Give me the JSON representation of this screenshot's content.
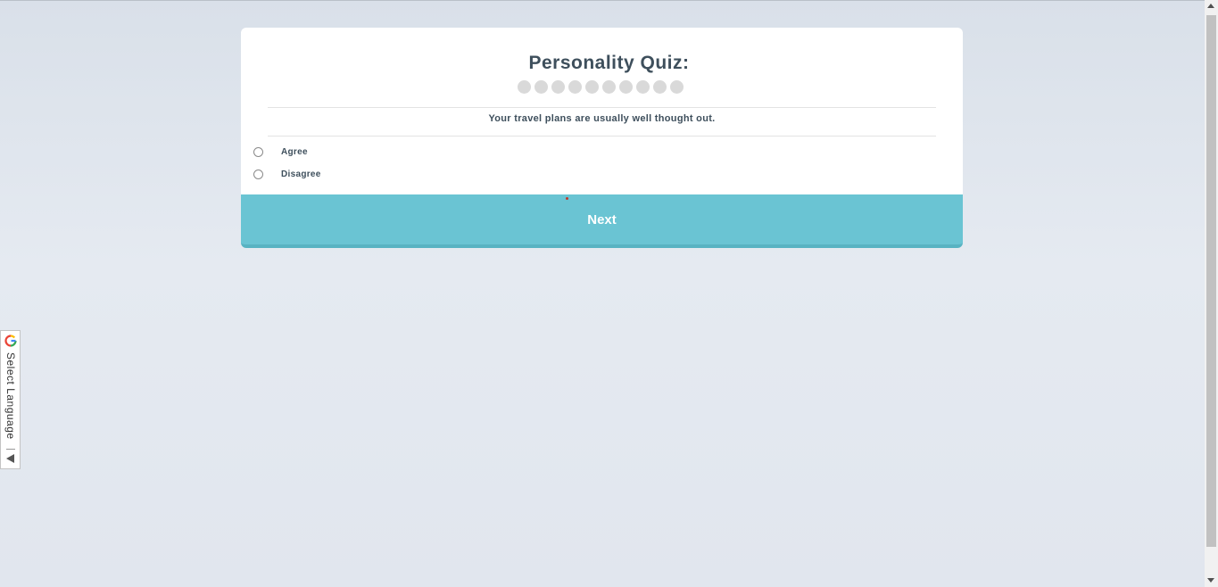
{
  "quiz": {
    "title": "Personality Quiz:",
    "progress": {
      "total_steps": 10,
      "completed_steps": 0
    },
    "question": "Your travel plans are usually well thought out.",
    "options": [
      {
        "label": "Agree",
        "selected": false
      },
      {
        "label": "Disagree",
        "selected": false
      }
    ],
    "next_label": "Next"
  },
  "language_widget": {
    "label": "Select Language",
    "icon": "google-g-icon"
  },
  "colors": {
    "accent": "#6ac4d3",
    "text": "#3e4f5c",
    "progress_dot": "#d9d9d9"
  }
}
